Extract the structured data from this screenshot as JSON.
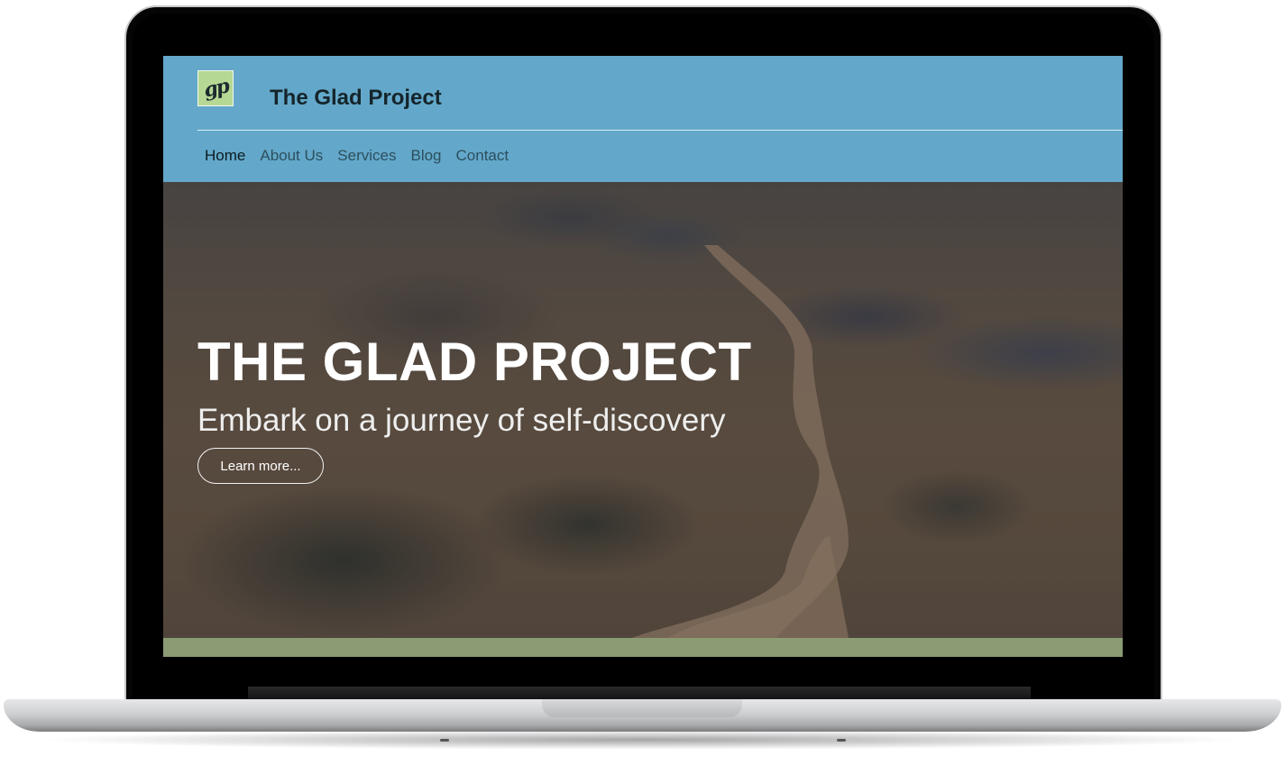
{
  "site": {
    "logo_text": "gp",
    "title": "The Glad Project"
  },
  "nav": {
    "items": [
      {
        "label": "Home",
        "active": true
      },
      {
        "label": "About Us",
        "active": false
      },
      {
        "label": "Services",
        "active": false
      },
      {
        "label": "Blog",
        "active": false
      },
      {
        "label": "Contact",
        "active": false
      }
    ]
  },
  "hero": {
    "title": "THE GLAD PROJECT",
    "subtitle": "Embark on a journey of self-discovery",
    "button_label": "Learn more..."
  },
  "colors": {
    "header_bg": "#63a8ca",
    "logo_bg": "#b6d895",
    "footer_band": "#8b9b74",
    "device_bezel": "#050505"
  }
}
